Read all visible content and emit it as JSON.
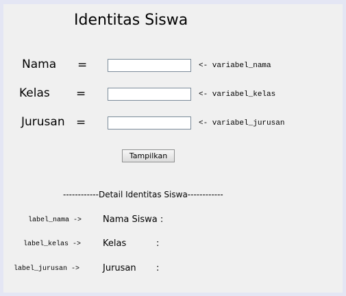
{
  "form": {
    "title": "Identitas Siswa",
    "fields": [
      {
        "label": "Nama",
        "equals": "=",
        "value": "",
        "hint": "<- variabel_nama"
      },
      {
        "label": "Kelas",
        "equals": "=",
        "value": "",
        "hint": "<- variabel_kelas"
      },
      {
        "label": "Jurusan",
        "equals": "=",
        "value": "",
        "hint": "<- variabel_jurusan"
      }
    ],
    "button_label": "Tampilkan"
  },
  "detail": {
    "separator": "------------Detail Identitas Siswa------------",
    "rows": [
      {
        "key": "label_nama ->",
        "label": "Nama Siswa :"
      },
      {
        "key": "label_kelas ->",
        "label": "Kelas",
        "colon": ":"
      },
      {
        "key": "label_jurusan ->",
        "label": "Jurusan",
        "colon": ":"
      }
    ]
  }
}
